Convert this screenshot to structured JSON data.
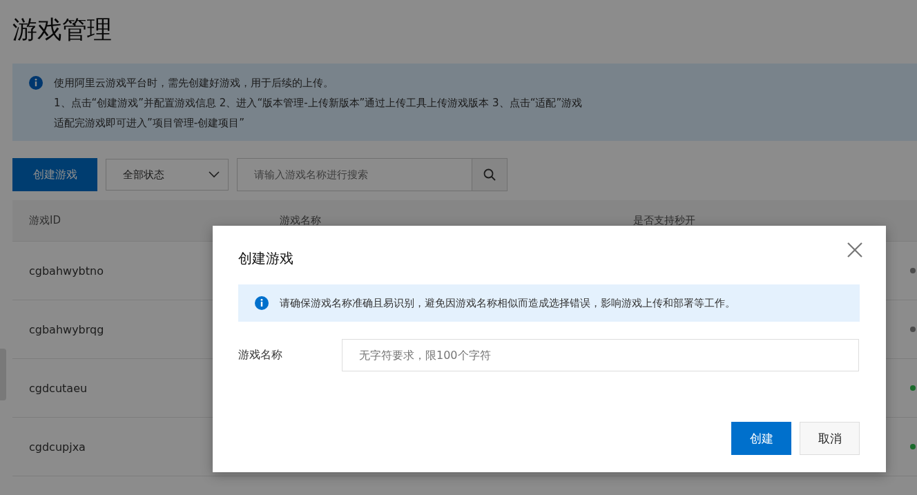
{
  "page": {
    "title": "游戏管理"
  },
  "notice": {
    "lines": [
      "使用阿里云游戏平台时，需先创建好游戏，用于后续的上传。",
      "1、点击“创建游戏”并配置游戏信息 2、进入“版本管理-上传新版本”通过上传工具上传游戏版本 3、点击“适配”游戏",
      "适配完游戏即可进入”项目管理-创建项目”"
    ]
  },
  "toolbar": {
    "create_button": "创建游戏",
    "status_filter": "全部状态",
    "search": {
      "placeholder": "请输入游戏名称进行搜索"
    }
  },
  "table": {
    "columns": [
      "游戏ID",
      "游戏名称",
      "是否支持秒开"
    ],
    "rows": [
      {
        "id": "cgbahwybtno",
        "color": "#4d4d4d"
      },
      {
        "id": "cgbahwybrqg",
        "color": "#4d4d4d"
      },
      {
        "id": "cgdcutaeu",
        "color": "#1b6b2c"
      },
      {
        "id": "cgdcupjxa",
        "color": "#1b6b2c"
      }
    ]
  },
  "dialog": {
    "title": "创建游戏",
    "tip": "请确保游戏名称准确且易识别，避免因游戏名称相似而造成选择错误，影响游戏上传和部署等工作。",
    "field_label": "游戏名称",
    "field_placeholder": "无字符要求，限100个字符",
    "buttons": [
      {
        "label": "创建",
        "kind": "primary"
      },
      {
        "label": "取消",
        "kind": "secondary"
      }
    ]
  }
}
